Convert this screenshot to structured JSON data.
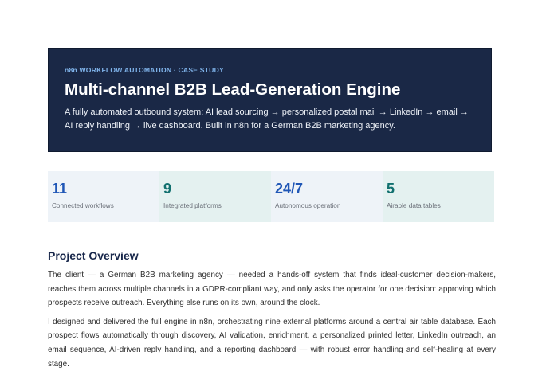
{
  "hero": {
    "kicker": "n8n WORKFLOW AUTOMATION · CASE STUDY",
    "title": "Multi-channel B2B Lead-Generation Engine",
    "subtitle": "A fully automated outbound system: AI lead sourcing → personalized postal mail → LinkedIn → email → AI reply handling → live dashboard. Built in n8n for a German B2B marketing agency."
  },
  "stats": [
    {
      "value": "11",
      "label": "Connected workflows"
    },
    {
      "value": "9",
      "label": "Integrated platforms"
    },
    {
      "value": "24/7",
      "label": "Autonomous operation"
    },
    {
      "value": "5",
      "label": "Airable data tables"
    }
  ],
  "overview": {
    "title": "Project Overview",
    "paragraph1": "The client — a German B2B marketing agency — needed a hands-off system that finds ideal-customer decision-makers, reaches them across multiple channels in a GDPR-compliant way, and only asks the operator for one decision: approving which prospects receive outreach. Everything else runs on its own, around the clock.",
    "paragraph2": "I designed and delivered the full engine in n8n, orchestrating nine external platforms around a central air table database. Each prospect flows automatically through discovery, AI validation, enrichment, a personalized printed letter, LinkedIn outreach, an email sequence, AI-driven reply handling, and a reporting dashboard — with robust error handling and self-healing at every stage."
  },
  "colors": {
    "hero_bg": "#1a2846",
    "kicker": "#7fb3ea",
    "stat_blue": "#1f56b6",
    "stat_teal": "#11706f",
    "heading": "#17264a"
  }
}
